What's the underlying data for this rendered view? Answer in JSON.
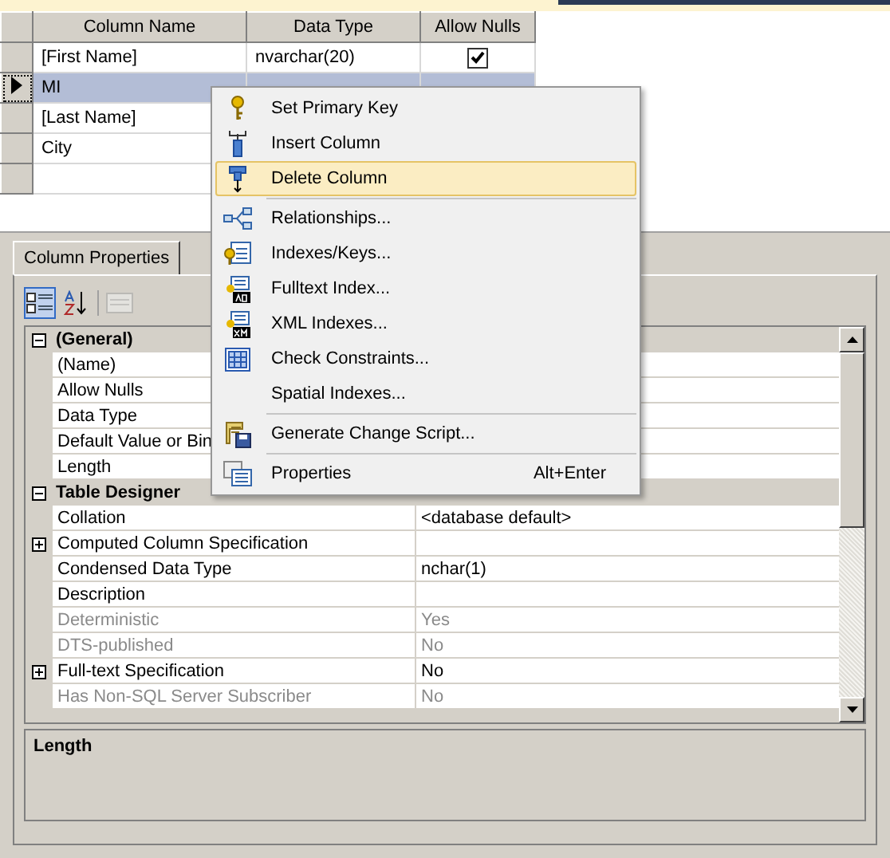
{
  "grid": {
    "columns": [
      "Column Name",
      "Data Type",
      "Allow Nulls"
    ],
    "rows": [
      {
        "name": "[First Name]",
        "data_type": "nvarchar(20)",
        "allow_nulls": true,
        "selected": false
      },
      {
        "name": "MI",
        "selected": true
      },
      {
        "name": "[Last Name]",
        "selected": false
      },
      {
        "name": "City",
        "selected": false
      }
    ]
  },
  "context_menu": {
    "items": [
      {
        "label": "Set Primary Key",
        "highlighted": false,
        "separator_before": false
      },
      {
        "label": "Insert Column",
        "highlighted": false,
        "separator_before": false
      },
      {
        "label": "Delete Column",
        "highlighted": true,
        "separator_before": false
      },
      {
        "label": "Relationships...",
        "highlighted": false,
        "separator_before": true
      },
      {
        "label": "Indexes/Keys...",
        "highlighted": false,
        "separator_before": false
      },
      {
        "label": "Fulltext Index...",
        "highlighted": false,
        "separator_before": false
      },
      {
        "label": "XML Indexes...",
        "highlighted": false,
        "separator_before": false
      },
      {
        "label": "Check Constraints...",
        "highlighted": false,
        "separator_before": false
      },
      {
        "label": "Spatial Indexes...",
        "highlighted": false,
        "separator_before": false
      },
      {
        "label": "Generate Change Script...",
        "highlighted": false,
        "separator_before": true
      },
      {
        "label": "Properties",
        "shortcut": "Alt+Enter",
        "highlighted": false,
        "separator_before": true
      }
    ]
  },
  "properties_tab": {
    "label": "Column Properties"
  },
  "properties": [
    {
      "kind": "category",
      "label": "(General)",
      "expanded": true
    },
    {
      "kind": "property",
      "label": "(Name)",
      "disabled": false
    },
    {
      "kind": "property",
      "label": "Allow Nulls",
      "disabled": false
    },
    {
      "kind": "property",
      "label": "Data Type",
      "disabled": false
    },
    {
      "kind": "property",
      "label": "Default Value or Bin",
      "disabled": false
    },
    {
      "kind": "property",
      "label": "Length",
      "disabled": false
    },
    {
      "kind": "category",
      "label": "Table Designer",
      "expanded": true
    },
    {
      "kind": "property",
      "label": "Collation",
      "value": "<database default>",
      "disabled": false
    },
    {
      "kind": "property",
      "label": "Computed Column Specification",
      "expandable": true,
      "disabled": false
    },
    {
      "kind": "property",
      "label": "Condensed Data Type",
      "value": "nchar(1)",
      "disabled": false
    },
    {
      "kind": "property",
      "label": "Description",
      "disabled": false
    },
    {
      "kind": "property",
      "label": "Deterministic",
      "value": "Yes",
      "disabled": true
    },
    {
      "kind": "property",
      "label": "DTS-published",
      "value": "No",
      "disabled": true
    },
    {
      "kind": "property",
      "label": "Full-text Specification",
      "value": "No",
      "expandable": true,
      "disabled": false
    },
    {
      "kind": "property",
      "label": "Has Non-SQL Server Subscriber",
      "value": "No",
      "disabled": true
    }
  ],
  "description": {
    "title": "Length"
  }
}
